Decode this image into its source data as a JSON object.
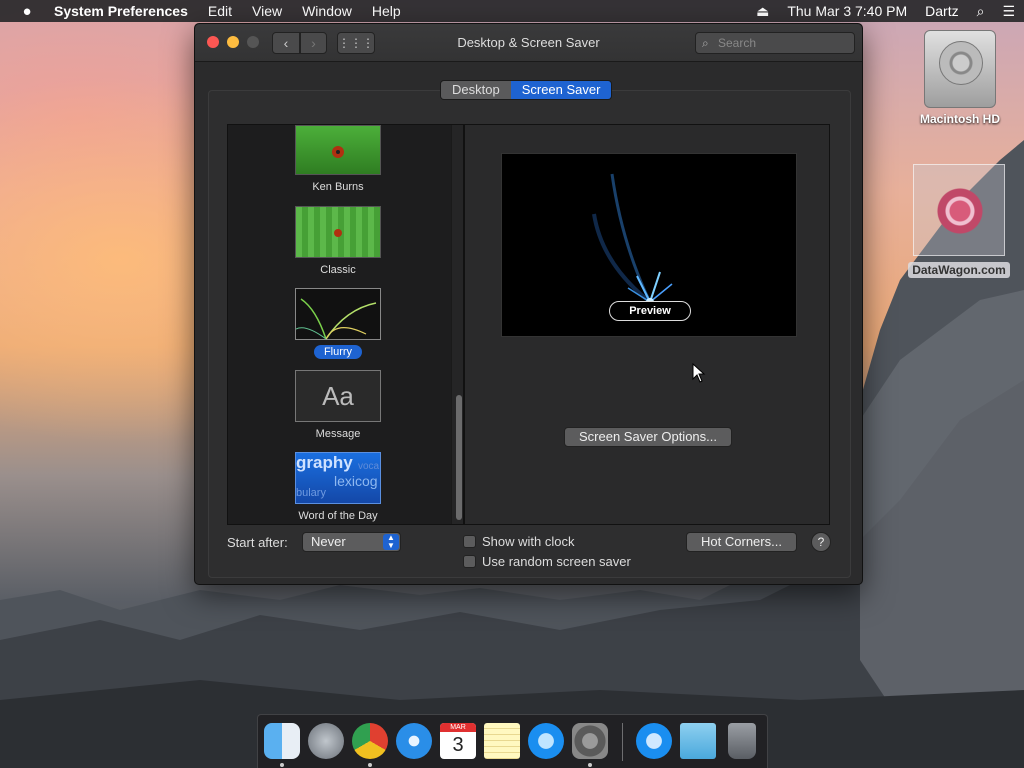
{
  "menubar": {
    "app_name": "System Preferences",
    "menus": [
      "Edit",
      "View",
      "Window",
      "Help"
    ],
    "clock": "Thu Mar 3  7:40 PM",
    "user": "Dartz"
  },
  "window": {
    "title": "Desktop & Screen Saver",
    "search_placeholder": "Search",
    "tabs": [
      "Desktop",
      "Screen Saver"
    ],
    "selected_tab": "Screen Saver"
  },
  "savers": [
    {
      "label": "Ken Burns",
      "selected": false
    },
    {
      "label": "Classic",
      "selected": false
    },
    {
      "label": "Flurry",
      "selected": true
    },
    {
      "label": "Message",
      "selected": false
    },
    {
      "label": "Word of the Day",
      "selected": false
    }
  ],
  "message_thumb_text": "Aa",
  "word_thumb_text": {
    "line1": "graphy",
    "line2": "lexicog",
    "line3": "bulary",
    "line4": "voca"
  },
  "preview": {
    "button_label": "Preview",
    "options_label": "Screen Saver Options..."
  },
  "controls": {
    "start_after_label": "Start after:",
    "start_after_value": "Never",
    "show_clock_label": "Show with clock",
    "random_label": "Use random screen saver",
    "hot_corners_label": "Hot Corners...",
    "help_label": "?"
  },
  "desktop_icons": [
    {
      "label": "Macintosh HD"
    },
    {
      "label": "DataWagon.com"
    }
  ],
  "dock": {
    "apps": [
      "finder-icon",
      "launchpad-icon",
      "chrome-icon",
      "safari-icon",
      "calendar-icon",
      "notes-icon",
      "app-store-icon",
      "system-preferences-icon",
      "app-store-download-icon",
      "downloads-folder-icon",
      "trash-icon"
    ],
    "calendar_month": "MAR",
    "calendar_day": "3"
  },
  "colors": {
    "accent": "#1e63d1",
    "window_bg": "#2b2b2c",
    "close": "#fc5753",
    "minimize": "#fdbc40"
  }
}
